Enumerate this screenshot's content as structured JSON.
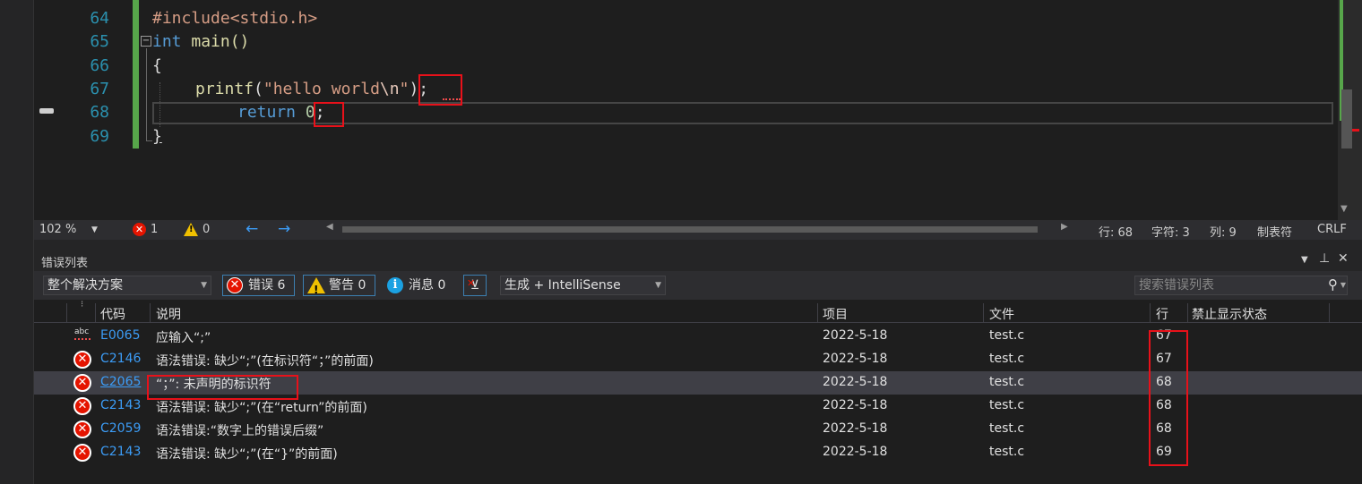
{
  "editor": {
    "line_numbers": [
      "64",
      "65",
      "66",
      "67",
      "68",
      "69"
    ],
    "lines": {
      "l64": "#include<stdio.h>",
      "l65_kw": "int",
      "l65_fn": " main()",
      "l66": "{",
      "l67_fn": "printf",
      "l67_open": "(",
      "l67_str1": "\"hello world",
      "l67_esc": "\\n",
      "l67_str2": "\"",
      "l67_close": ");",
      "l68_kw": "return",
      "l68_num": "0",
      "l68_semi": ";",
      "l69": "}"
    }
  },
  "status_strip": {
    "zoom": "102 %",
    "errors": "1",
    "warnings": "0",
    "line": "行: 68",
    "char": "字符: 3",
    "col": "列: 9",
    "indent": "制表符",
    "eol": "CRLF"
  },
  "error_list": {
    "title": "错误列表",
    "scope": "整个解决方案",
    "errors_btn": "错误 6",
    "warnings_btn": "警告 0",
    "messages_btn": "消息 0",
    "source": "生成 + IntelliSense",
    "search_placeholder": "搜索错误列表",
    "columns": {
      "code": "代码",
      "desc": "说明",
      "project": "项目",
      "file": "文件",
      "line": "行",
      "suppress": "禁止显示状态"
    },
    "rows": [
      {
        "kind": "intellisense",
        "code": "E0065",
        "desc": "应输入“;”",
        "project": "2022-5-18",
        "file": "test.c",
        "line": "67"
      },
      {
        "kind": "error",
        "code": "C2146",
        "desc": "语法错误: 缺少“;”(在标识符“；”的前面)",
        "project": "2022-5-18",
        "file": "test.c",
        "line": "67"
      },
      {
        "kind": "error",
        "code": "C2065",
        "desc": "“；”: 未声明的标识符",
        "project": "2022-5-18",
        "file": "test.c",
        "line": "68"
      },
      {
        "kind": "error",
        "code": "C2143",
        "desc": "语法错误: 缺少“;”(在“return”的前面)",
        "project": "2022-5-18",
        "file": "test.c",
        "line": "68"
      },
      {
        "kind": "error",
        "code": "C2059",
        "desc": "语法错误:“数字上的错误后缀”",
        "project": "2022-5-18",
        "file": "test.c",
        "line": "68"
      },
      {
        "kind": "error",
        "code": "C2143",
        "desc": "语法错误: 缺少“;”(在“}”的前面)",
        "project": "2022-5-18",
        "file": "test.c",
        "line": "69"
      }
    ]
  },
  "colors": {
    "error_red": "#e51400",
    "annotation_red": "#e8111a",
    "link_blue": "#3c9cf6",
    "change_green": "#57a64a"
  },
  "icons": [
    "bookmark-icon",
    "error-icon",
    "warning-icon",
    "info-icon",
    "filter-icon",
    "search-icon",
    "pin-icon",
    "close-icon",
    "chevron-down-icon",
    "arrow-left-icon",
    "arrow-right-icon",
    "spellcheck-icon"
  ]
}
